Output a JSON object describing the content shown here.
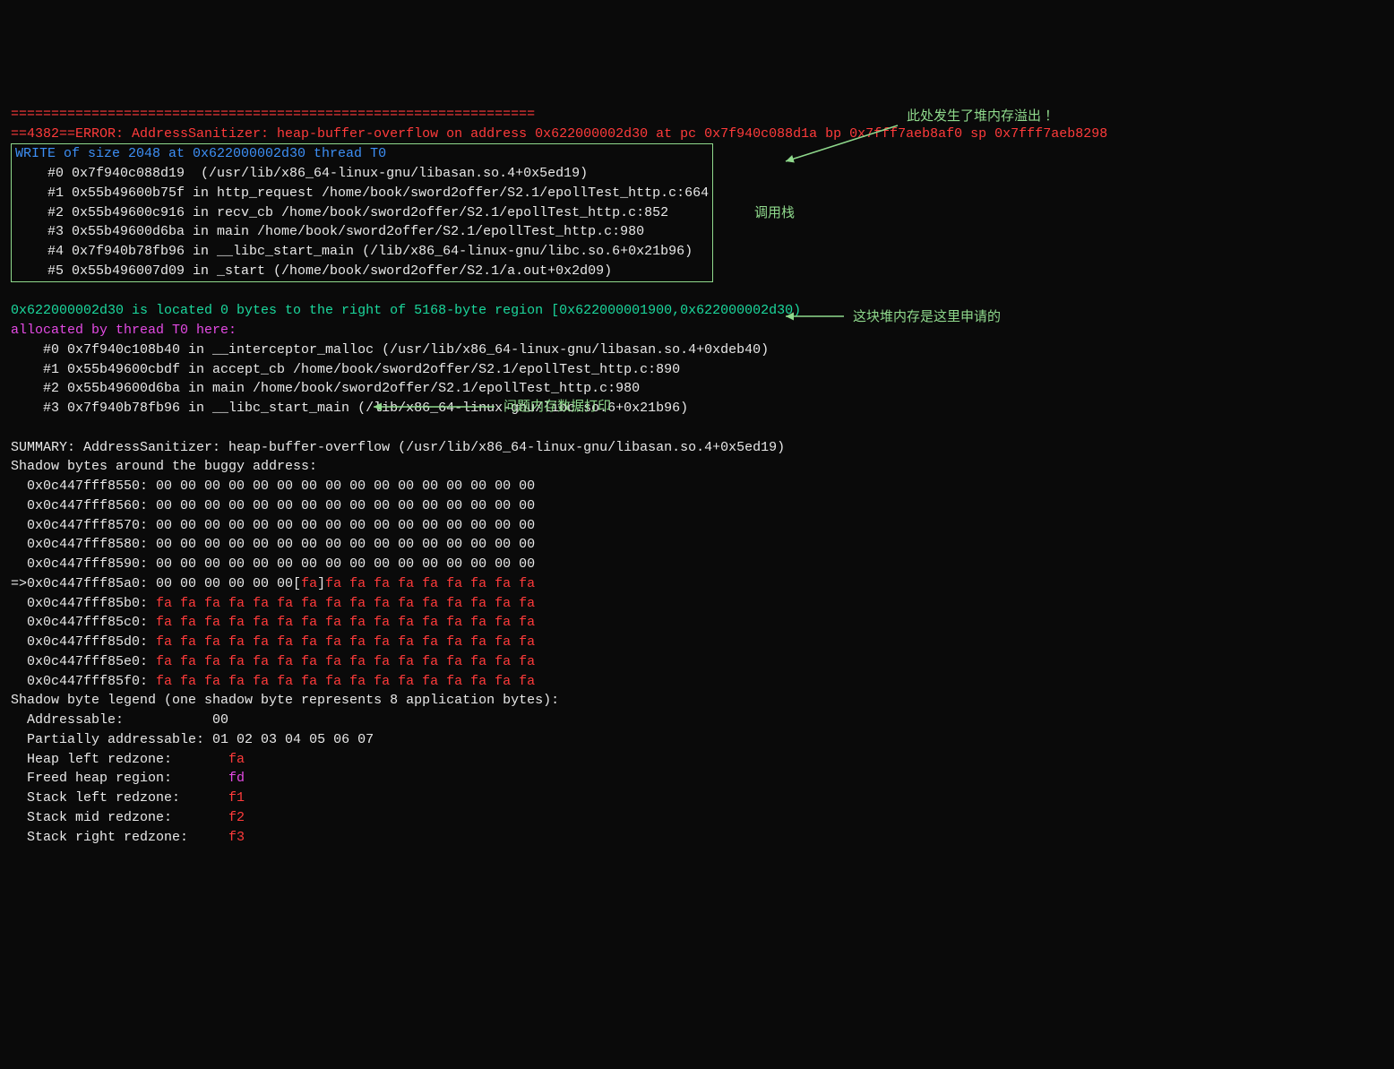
{
  "separator": "=================================================================",
  "error_header": "==4382==ERROR: AddressSanitizer: heap-buffer-overflow on address 0x622000002d30 at pc 0x7f940c088d1a bp 0x7fff7aeb8af0 sp 0x7fff7aeb8298",
  "write_header": "WRITE of size 2048 at 0x622000002d30 thread T0",
  "stack1": [
    "    #0 0x7f940c088d19  (/usr/lib/x86_64-linux-gnu/libasan.so.4+0x5ed19)",
    "    #1 0x55b49600b75f in http_request /home/book/sword2offer/S2.1/epollTest_http.c:664",
    "    #2 0x55b49600c916 in recv_cb /home/book/sword2offer/S2.1/epollTest_http.c:852",
    "    #3 0x55b49600d6ba in main /home/book/sword2offer/S2.1/epollTest_http.c:980",
    "    #4 0x7f940b78fb96 in __libc_start_main (/lib/x86_64-linux-gnu/libc.so.6+0x21b96)",
    "    #5 0x55b496007d09 in _start (/home/book/sword2offer/S2.1/a.out+0x2d09)"
  ],
  "located": "0x622000002d30 is located 0 bytes to the right of 5168-byte region [0x622000001900,0x622000002d30)",
  "alloc_header": "allocated by thread T0 here:",
  "stack2": [
    "    #0 0x7f940c108b40 in __interceptor_malloc (/usr/lib/x86_64-linux-gnu/libasan.so.4+0xdeb40)",
    "    #1 0x55b49600cbdf in accept_cb /home/book/sword2offer/S2.1/epollTest_http.c:890",
    "    #2 0x55b49600d6ba in main /home/book/sword2offer/S2.1/epollTest_http.c:980",
    "    #3 0x7f940b78fb96 in __libc_start_main (/lib/x86_64-linux-gnu/libc.so.6+0x21b96)"
  ],
  "summary": "SUMMARY: AddressSanitizer: heap-buffer-overflow (/usr/lib/x86_64-linux-gnu/libasan.so.4+0x5ed19) ",
  "shadow_header": "Shadow bytes around the buggy address:",
  "shadow_rows": [
    {
      "addr": "  0x0c447fff8550:",
      "pre": " 00 00 00 00 00 00 00 00 00 00 00 00 00 00 00 00",
      "mid": "",
      "post": ""
    },
    {
      "addr": "  0x0c447fff8560:",
      "pre": " 00 00 00 00 00 00 00 00 00 00 00 00 00 00 00 00",
      "mid": "",
      "post": ""
    },
    {
      "addr": "  0x0c447fff8570:",
      "pre": " 00 00 00 00 00 00 00 00 00 00 00 00 00 00 00 00",
      "mid": "",
      "post": ""
    },
    {
      "addr": "  0x0c447fff8580:",
      "pre": " 00 00 00 00 00 00 00 00 00 00 00 00 00 00 00 00",
      "mid": "",
      "post": ""
    },
    {
      "addr": "  0x0c447fff8590:",
      "pre": " 00 00 00 00 00 00 00 00 00 00 00 00 00 00 00 00",
      "mid": "",
      "post": ""
    },
    {
      "addr": "=>0x0c447fff85a0:",
      "pre": " 00 00 00 00 00 00[",
      "mid": "fa",
      "post": "]fa fa fa fa fa fa fa fa fa"
    },
    {
      "addr": "  0x0c447fff85b0:",
      "pre": " ",
      "mid": "",
      "post": "fa fa fa fa fa fa fa fa fa fa fa fa fa fa fa fa"
    },
    {
      "addr": "  0x0c447fff85c0:",
      "pre": " ",
      "mid": "",
      "post": "fa fa fa fa fa fa fa fa fa fa fa fa fa fa fa fa"
    },
    {
      "addr": "  0x0c447fff85d0:",
      "pre": " ",
      "mid": "",
      "post": "fa fa fa fa fa fa fa fa fa fa fa fa fa fa fa fa"
    },
    {
      "addr": "  0x0c447fff85e0:",
      "pre": " ",
      "mid": "",
      "post": "fa fa fa fa fa fa fa fa fa fa fa fa fa fa fa fa"
    },
    {
      "addr": "  0x0c447fff85f0:",
      "pre": " ",
      "mid": "",
      "post": "fa fa fa fa fa fa fa fa fa fa fa fa fa fa fa fa"
    }
  ],
  "legend_header": "Shadow byte legend (one shadow byte represents 8 application bytes):",
  "legend": [
    {
      "label": "  Addressable:           ",
      "code": "00",
      "cls": "white"
    },
    {
      "label": "  Partially addressable: ",
      "code": "01 02 03 04 05 06 07",
      "cls": "white"
    },
    {
      "label": "  Heap left redzone:       ",
      "code": "fa",
      "cls": "red"
    },
    {
      "label": "  Freed heap region:       ",
      "code": "fd",
      "cls": "magenta"
    },
    {
      "label": "  Stack left redzone:      ",
      "code": "f1",
      "cls": "red"
    },
    {
      "label": "  Stack mid redzone:       ",
      "code": "f2",
      "cls": "red"
    },
    {
      "label": "  Stack right redzone:     ",
      "code": "f3",
      "cls": "red"
    }
  ],
  "annotations": {
    "overflow": "此处发生了堆内存溢出 ！",
    "callstack": "调用栈",
    "alloc": "这块堆内存是这里申请的",
    "memdump": "问题内存数据打印"
  }
}
